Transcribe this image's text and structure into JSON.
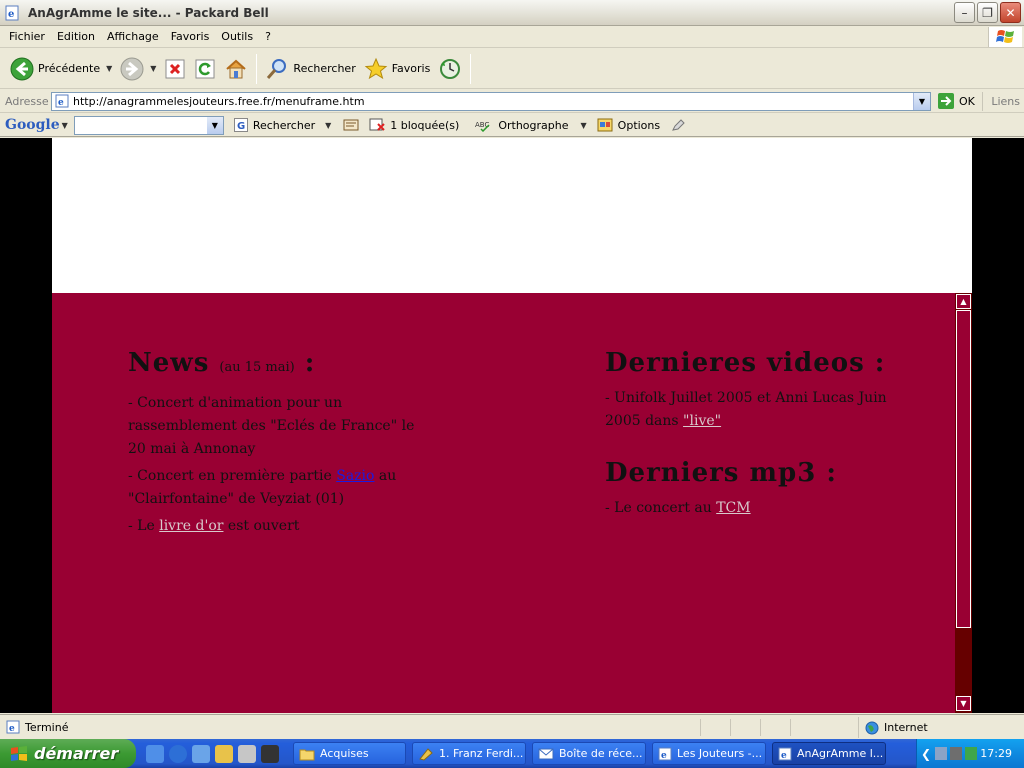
{
  "window": {
    "title": "AnAgrAmme le site... - Packard Bell"
  },
  "menu": [
    "Fichier",
    "Edition",
    "Affichage",
    "Favoris",
    "Outils",
    "?"
  ],
  "toolbar": {
    "back_label": "Précédente",
    "search_label": "Rechercher",
    "favorites_label": "Favoris"
  },
  "address": {
    "label": "Adresse",
    "url": "http://anagrammelesjouteurs.free.fr/menuframe.htm",
    "go_label": "OK",
    "links_label": "Liens"
  },
  "google": {
    "logo": "Google",
    "search_label": "Rechercher",
    "blocked_label": "1 bloquée(s)",
    "spell_label": "Orthographe",
    "options_label": "Options"
  },
  "content": {
    "news_title": "News",
    "news_date": "(au 15 mai)",
    "news_colon": ":",
    "news1": "- Concert d'animation pour un rassemblement des \"Eclés de France\" le 20 mai à Annonay",
    "news2_pre": "- Concert en première partie ",
    "news2_link": "Sazio",
    "news2_mid": " au \"Clairfontaine\" de Veyziat (01)",
    "news3_pre": "- Le ",
    "news3_link": "livre d'or",
    "news3_post": " est ouvert",
    "videos_title": "Dernieres videos :",
    "videos_text": "- Unifolk Juillet 2005 et Anni Lucas Juin 2005 dans ",
    "videos_link": "\"live\"",
    "mp3_title": "Derniers mp3 :",
    "mp3_text": "- Le concert au ",
    "mp3_link": "TCM"
  },
  "status": {
    "text": "Terminé",
    "zone": "Internet"
  },
  "taskbar": {
    "start_label": "démarrer",
    "tasks": [
      "Acquises",
      "1. Franz Ferdi...",
      "Boîte de réce...",
      "Les Jouteurs -...",
      "AnAgrAmme l..."
    ],
    "clock": "17:29"
  },
  "colors": {
    "page_bg": "#990033",
    "scroll_track": "#660000",
    "link_light": "#D8C9CC",
    "link_blue": "#1A1AE0"
  }
}
